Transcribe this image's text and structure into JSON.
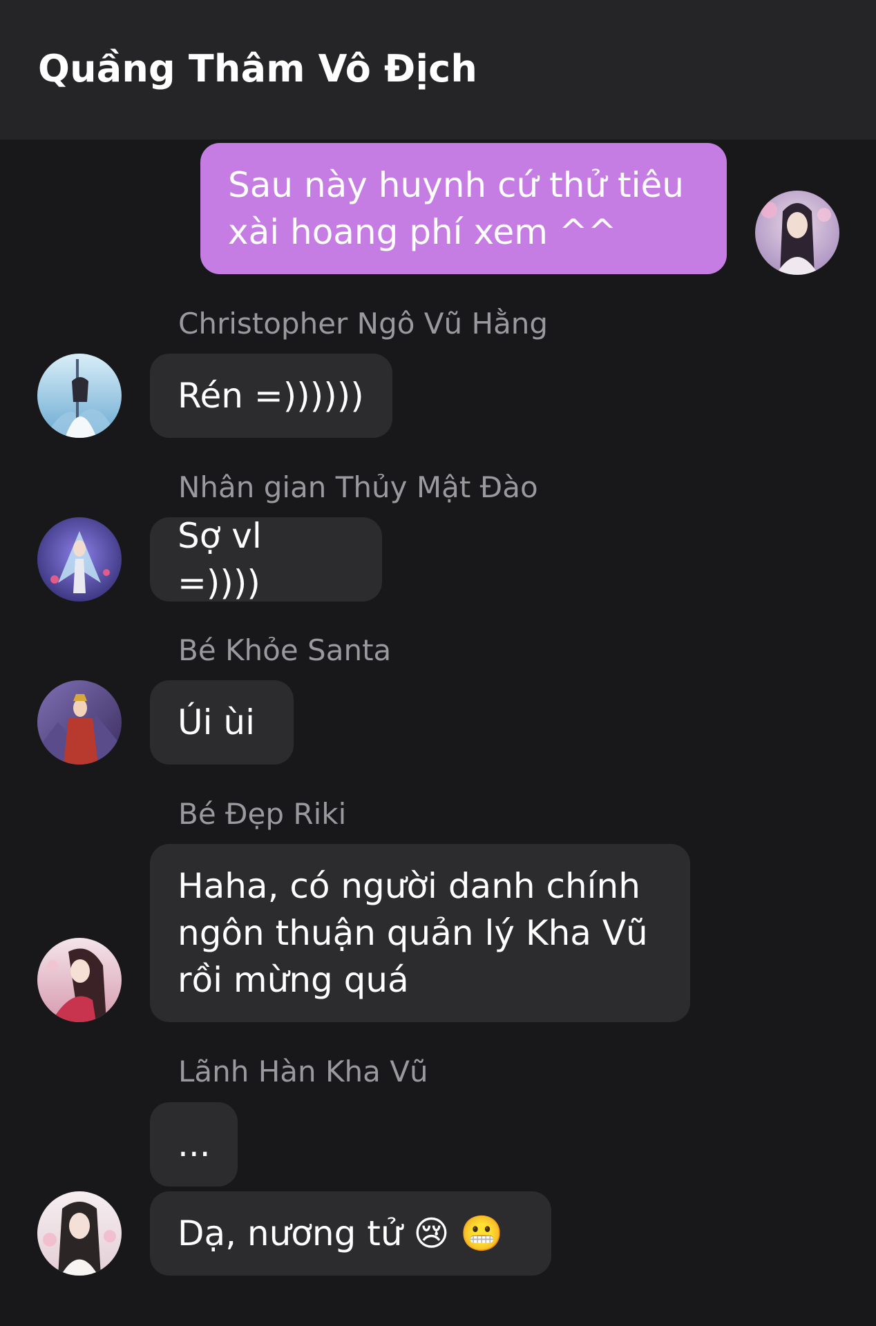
{
  "header": {
    "title": "Quầng Thâm Vô Địch"
  },
  "messages": [
    {
      "sender": "",
      "text_lines": [
        "Sau này huynh cứ thử tiêu",
        "xài hoang phí xem ^^"
      ],
      "mine": true
    },
    {
      "sender": "Christopher Ngô Vũ Hằng",
      "text": "Rén =))))))"
    },
    {
      "sender": "Nhân gian Thủy Mật Đào",
      "text": "Sợ vl =))))"
    },
    {
      "sender": "Bé Khỏe Santa",
      "text": "Úi ùi"
    },
    {
      "sender": "Bé Đẹp Riki",
      "text_lines": [
        "Haha, có người danh chính",
        "ngôn thuận quản lý Kha Vũ",
        "rồi mừng quá"
      ]
    },
    {
      "sender": "Lãnh Hàn Kha Vũ",
      "text": "..."
    },
    {
      "sender": "",
      "text": "Dạ, nương tử 😢 😬"
    }
  ],
  "colors": {
    "header_bg": "#252527",
    "chat_bg": "#18181a",
    "mine_bubble": "#c57de3",
    "other_bubble": "#2c2c2e",
    "sender_text": "#9a9a9e"
  }
}
